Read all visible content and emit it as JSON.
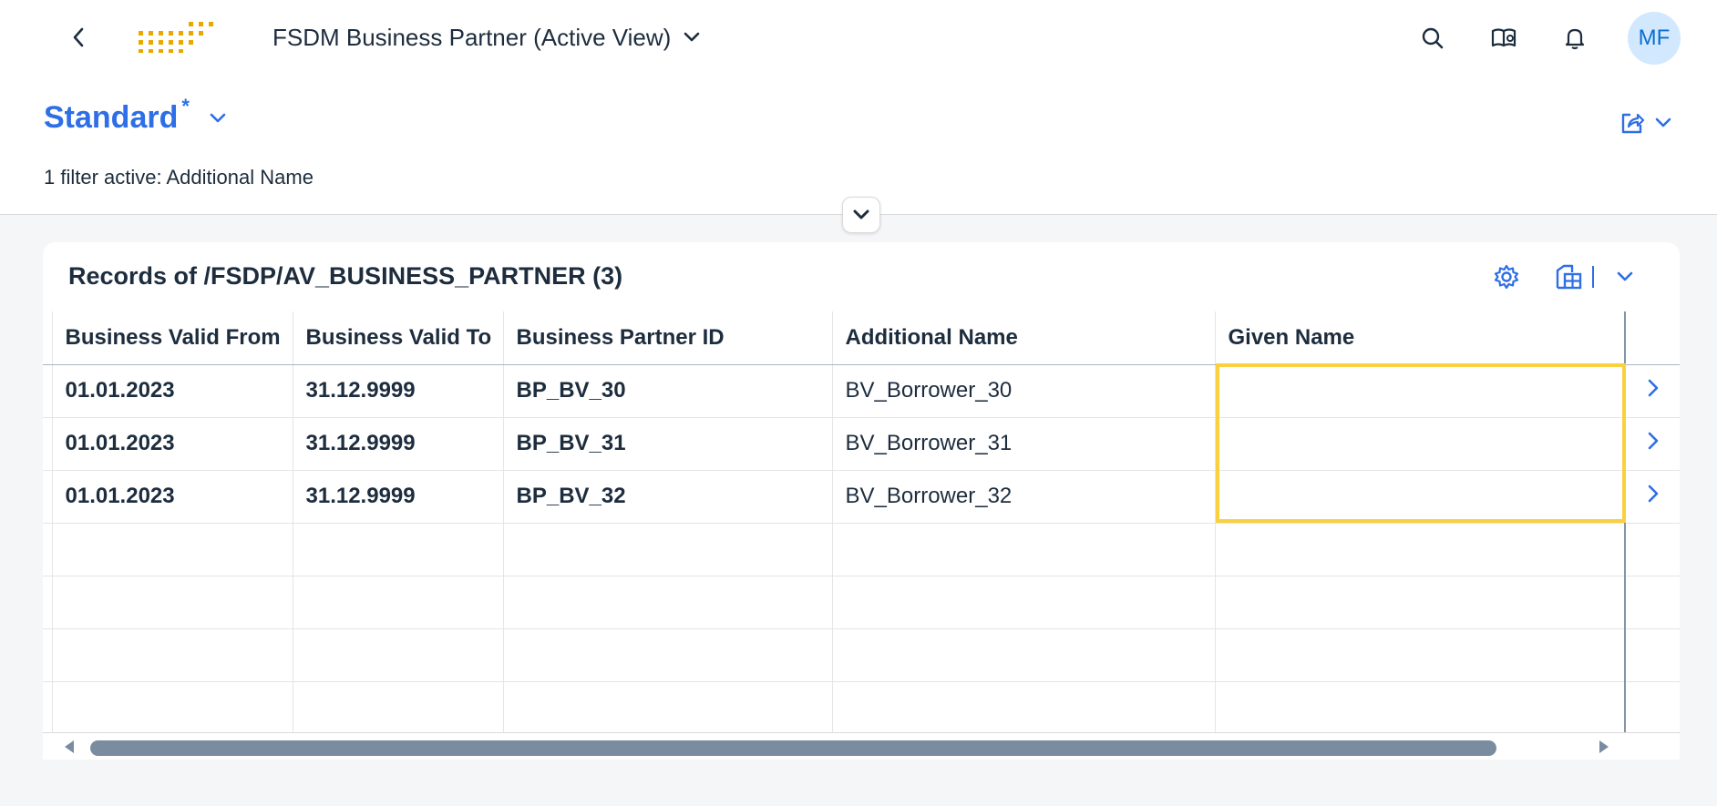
{
  "shell": {
    "app_title": "FSDM Business Partner (Active View)",
    "avatar_initials": "MF",
    "logo_color": "#e9a800"
  },
  "header": {
    "variant_name": "Standard",
    "variant_modified_marker": "*",
    "filter_info": "1 filter active: Additional Name"
  },
  "table": {
    "title": "Records of /FSDP/AV_BUSINESS_PARTNER (3)",
    "columns": [
      "Business Valid From",
      "Business Valid To",
      "Business Partner ID",
      "Additional Name",
      "Given Name"
    ],
    "rows": [
      {
        "valid_from": "01.01.2023",
        "valid_to": "31.12.9999",
        "bp_id": "BP_BV_30",
        "additional_name": "BV_Borrower_30",
        "given_name": ""
      },
      {
        "valid_from": "01.01.2023",
        "valid_to": "31.12.9999",
        "bp_id": "BP_BV_31",
        "additional_name": "BV_Borrower_31",
        "given_name": ""
      },
      {
        "valid_from": "01.01.2023",
        "valid_to": "31.12.9999",
        "bp_id": "BP_BV_32",
        "additional_name": "BV_Borrower_32",
        "given_name": ""
      }
    ]
  },
  "colors": {
    "accent": "#2e6ee6",
    "highlight": "#f9d13f",
    "text": "#1d2d3e"
  },
  "icons": {
    "back": "chevron-left-icon",
    "search": "search-icon",
    "help": "help-book-icon",
    "notifications": "bell-icon",
    "share": "share-icon",
    "settings": "gear-icon",
    "export": "export-spreadsheet-icon"
  }
}
